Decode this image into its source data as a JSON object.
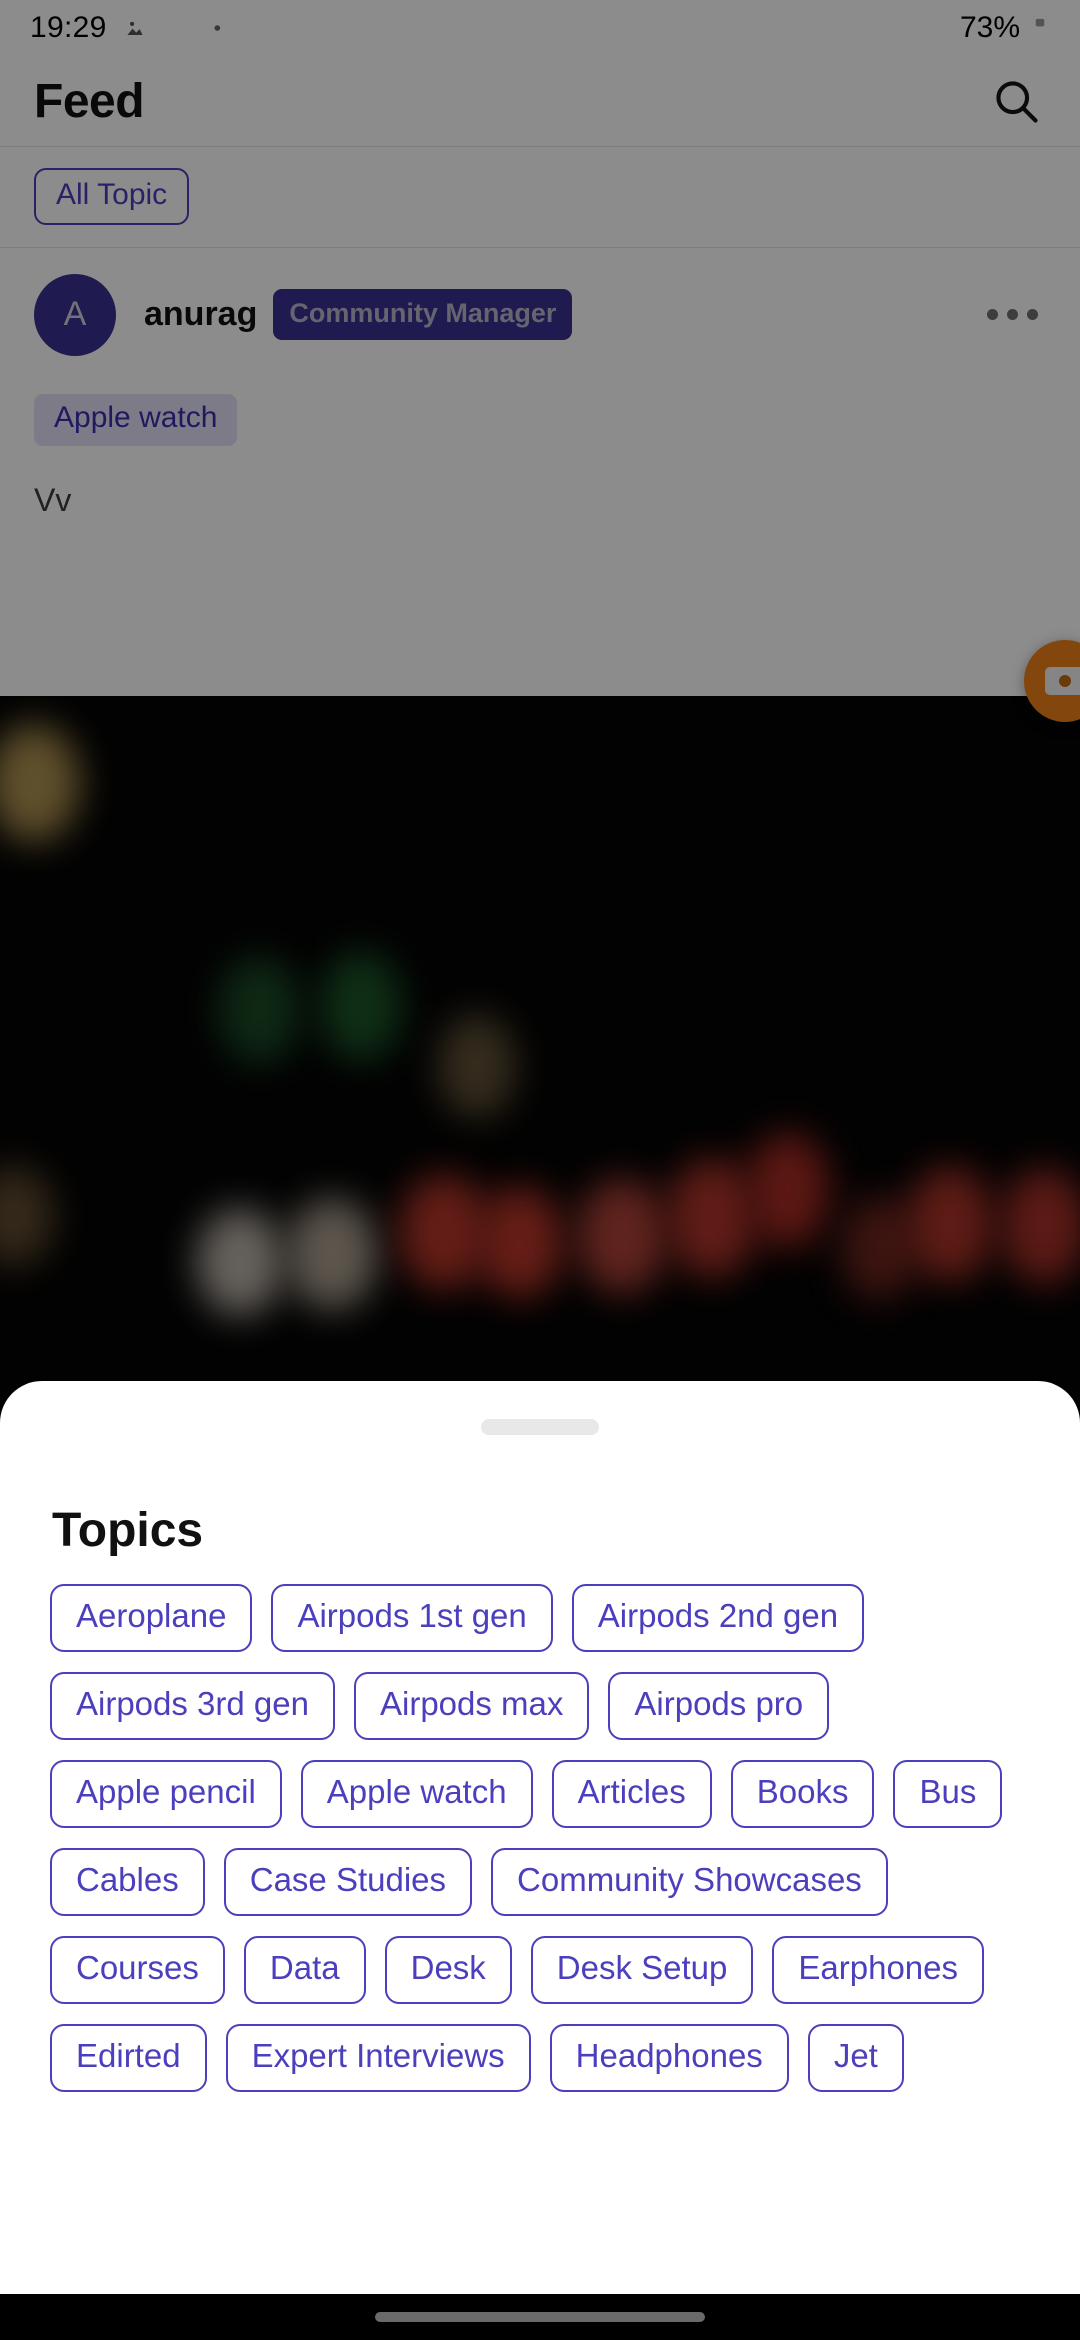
{
  "status_bar": {
    "time": "19:29",
    "icons": [
      "image-icon",
      "gmail-icon",
      "video-camera-icon",
      "dot-icon"
    ],
    "wifi": "wifi-icon",
    "signal": "signal-bars-icon",
    "battery_percent": "73%",
    "battery": "battery-icon"
  },
  "app_bar": {
    "title": "Feed",
    "search_icon": "search-icon"
  },
  "topic_filter": {
    "chip_label": "All Topic"
  },
  "post": {
    "avatar_initial": "A",
    "username": "anurag",
    "role_badge": "Community Manager",
    "more_icon": "more-horizontal-icon",
    "topic_tag": "Apple watch",
    "body": "Vv"
  },
  "video": {
    "play_icon": "play-icon"
  },
  "fab": {
    "icon": "video-record-icon",
    "color": "#ef8016"
  },
  "bottom_sheet": {
    "handle": "drag-handle",
    "title": "Topics",
    "topics": [
      "Aeroplane",
      "Airpods 1st gen",
      "Airpods 2nd gen",
      "Airpods 3rd gen",
      "Airpods max",
      "Airpods pro",
      "Apple pencil",
      "Apple watch",
      "Articles",
      "Books",
      "Bus",
      "Cables",
      "Case Studies",
      "Community Showcases",
      "Courses",
      "Data",
      "Desk",
      "Desk Setup",
      "Earphones",
      "Edirted",
      "Expert Interviews",
      "Headphones",
      "Jet"
    ]
  },
  "nav_bar": {
    "pill": "home-indicator"
  },
  "colors": {
    "accent": "#4b3fbe",
    "badge": "#3a3093",
    "tag_bg": "#e4e1f6",
    "fab": "#ef8016"
  }
}
